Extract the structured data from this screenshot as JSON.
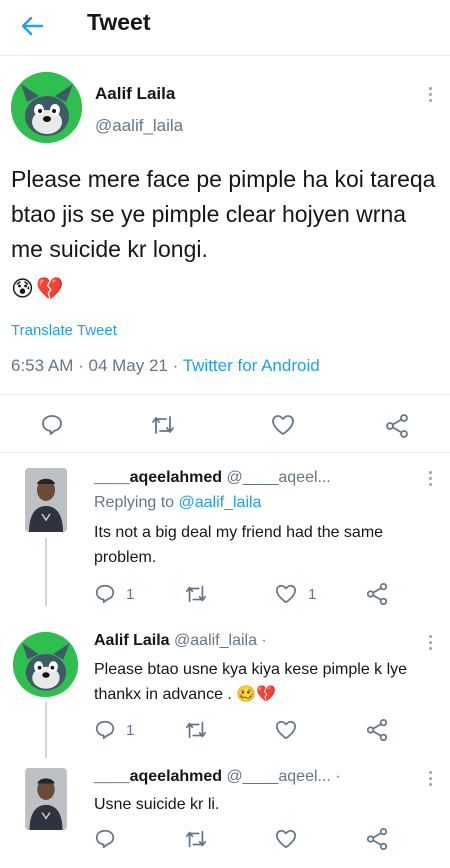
{
  "header": {
    "title": "Tweet"
  },
  "tweet": {
    "name": "Aalif Laila",
    "handle": "@aalif_laila",
    "text": "Please mere face pe pimple ha koi tareqa btao jis se ye pimple clear hojyen wrna me suicide kr longi.",
    "emojis": [
      "😰",
      "💔"
    ],
    "translate": "Translate Tweet",
    "time": "6:53 AM",
    "date": "04 May 21",
    "source": "Twitter for Android",
    "sep1": " · ",
    "sep2": " · "
  },
  "replies": [
    {
      "name": "____aqeelahmed",
      "handle": "@____aqeel...",
      "replying_prefix": "Replying to ",
      "replying_to": "@aalif_laila",
      "text": "Its not a big deal my friend had the same problem.",
      "reply_count": "1",
      "like_count": "1"
    },
    {
      "name": "Aalif Laila",
      "handle": "@aalif_laila ·",
      "text": "Please btao usne kya kiya kese pimple k lye thankx in advance .",
      "emojis": [
        "🥴",
        "💔"
      ],
      "reply_count": "1"
    },
    {
      "name": "____aqeelahmed",
      "handle": "@____aqeel... ·",
      "text": "Usne suicide kr li."
    }
  ],
  "colors": {
    "accent": "#1da1f2",
    "muted": "#657786",
    "avatar_green": "#2fbf4f"
  },
  "icons": [
    "back-arrow-icon",
    "reply-icon",
    "retweet-icon",
    "like-icon",
    "share-icon",
    "more-icon"
  ]
}
